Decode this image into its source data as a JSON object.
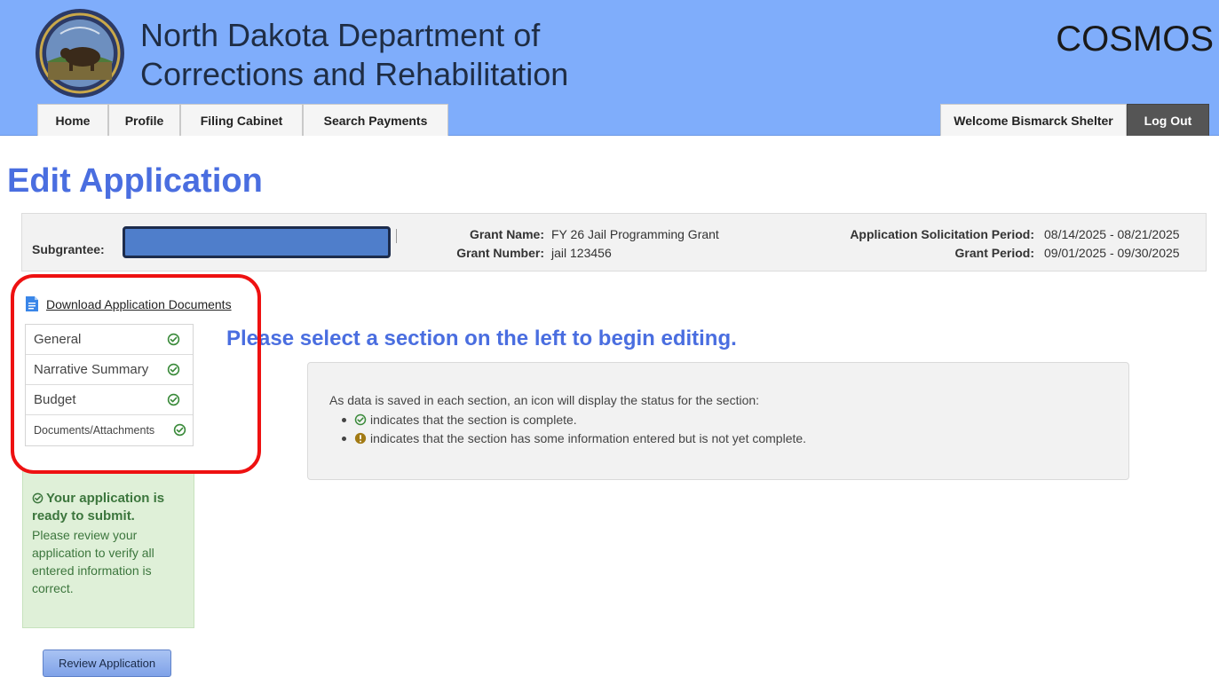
{
  "header": {
    "agency_line1": "North Dakota Department of",
    "agency_line2": "Corrections and Rehabilitation",
    "app_name": "COSMOS",
    "brand_color": "#7fadfb"
  },
  "nav": {
    "tabs": [
      {
        "label": "Home"
      },
      {
        "label": "Profile"
      },
      {
        "label": "Filing Cabinet"
      },
      {
        "label": "Search Payments"
      }
    ],
    "welcome": "Welcome Bismarck Shelter",
    "logout": "Log Out"
  },
  "page": {
    "title": "Edit Application"
  },
  "info": {
    "subgrantee_label": "Subgrantee:",
    "grant_name_label": "Grant Name:",
    "grant_name": "FY 26 Jail Programming Grant",
    "grant_number_label": "Grant Number:",
    "grant_number": "jail 123456",
    "solicitation_label": "Application Solicitation Period:",
    "solicitation_period": "08/14/2025 - 08/21/2025",
    "grant_period_label": "Grant Period:",
    "grant_period": "09/01/2025 - 09/30/2025"
  },
  "sidebar": {
    "download_label": "Download Application Documents",
    "sections": [
      {
        "label": "General",
        "status": "complete"
      },
      {
        "label": "Narrative Summary",
        "status": "complete"
      },
      {
        "label": "Budget",
        "status": "complete"
      },
      {
        "label": "Documents/Attachments",
        "status": "complete"
      }
    ]
  },
  "main": {
    "prompt": "Please select a section on the left to begin editing.",
    "status_intro": "As data is saved in each section, an icon will display the status for the section:",
    "status_complete": "indicates that the section is complete.",
    "status_incomplete": "indicates that the section has some information entered but is not yet complete."
  },
  "ready": {
    "title": "Your application is ready to submit.",
    "text": "Please review your application to verify all entered information is correct."
  },
  "actions": {
    "review_label": "Review Application"
  },
  "colors": {
    "title_blue": "#4a6ee0",
    "complete_green": "#3a8a3a",
    "incomplete_amber": "#a27a14",
    "annotation_red": "#ee1111"
  },
  "icons": {
    "seal": "state-seal-icon",
    "download": "document-icon",
    "complete": "check-circle-icon",
    "incomplete": "exclamation-circle-icon"
  }
}
